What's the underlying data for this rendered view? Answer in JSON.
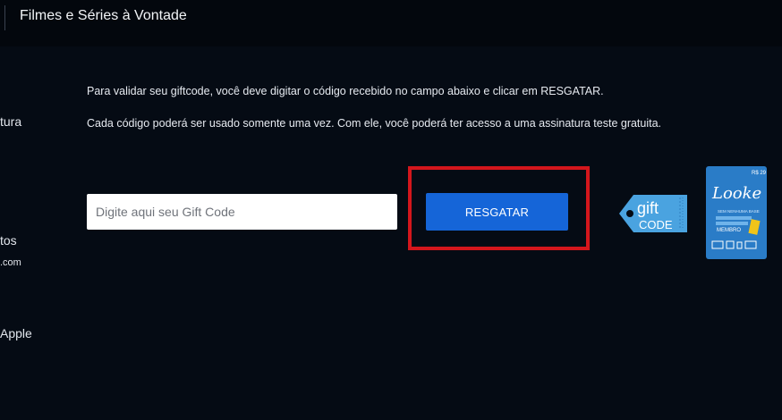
{
  "header": {
    "title": "Filmes e Séries à Vontade"
  },
  "sidebar": {
    "items": [
      {
        "label": "tura"
      },
      {
        "label": "tos"
      },
      {
        "label": ".com"
      },
      {
        "label": "Apple"
      }
    ]
  },
  "main": {
    "instruction_1": "Para validar seu giftcode, você deve digitar o código recebido no campo abaixo e clicar em RESGATAR.",
    "instruction_2": "Cada código poderá ser usado somente uma vez. Com ele, você poderá ter acesso a uma assinatura teste gratuita.",
    "giftcode_input": {
      "placeholder": "Digite aqui seu Gift Code",
      "value": ""
    },
    "redeem_button_label": "RESGATAR"
  },
  "images": {
    "gift_tag": {
      "line1": "gift",
      "line2": "CODE"
    },
    "gift_card": {
      "brand": "Looke",
      "price": "R$ 29",
      "tagline": "SEM NENHUMA BASE",
      "member_text": "MEMBRO"
    }
  },
  "colors": {
    "background": "#050b14",
    "topbar": "#03070d",
    "button": "#1565d8",
    "highlight": "#d4161c",
    "tag": "#4aa3e0",
    "card": "#2a7cc7"
  }
}
